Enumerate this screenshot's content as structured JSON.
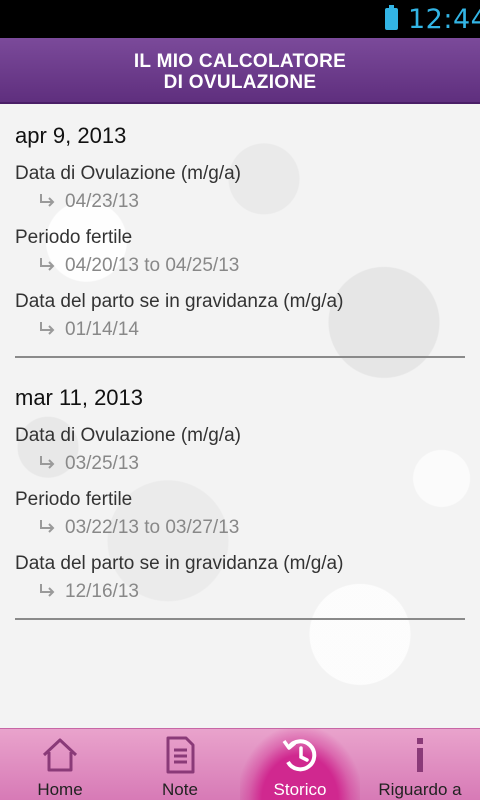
{
  "status_bar": {
    "time": "12:44",
    "battery_icon": "battery-full-icon"
  },
  "header": {
    "title_line1": "IL MIO CALCOLATORE",
    "title_line2": "DI OVULAZIONE"
  },
  "entries": [
    {
      "date": "apr 9, 2013",
      "ovulation_label": "Data di Ovulazione (m/g/a)",
      "ovulation_value": "04/23/13",
      "fertile_label": "Periodo fertile",
      "fertile_value": "04/20/13 to 04/25/13",
      "due_label": "Data del parto se in gravidanza (m/g/a)",
      "due_value": "01/14/14"
    },
    {
      "date": "mar 11, 2013",
      "ovulation_label": "Data di Ovulazione (m/g/a)",
      "ovulation_value": "03/25/13",
      "fertile_label": "Periodo fertile",
      "fertile_value": "03/22/13 to 03/27/13",
      "due_label": "Data del parto se in gravidanza (m/g/a)",
      "due_value": "12/16/13"
    }
  ],
  "nav": {
    "tabs": [
      {
        "label": "Home",
        "icon": "home-icon"
      },
      {
        "label": "Note",
        "icon": "notes-icon"
      },
      {
        "label": "Storico",
        "icon": "history-icon",
        "active": true
      },
      {
        "label": "Riguardo a",
        "icon": "info-icon"
      }
    ]
  },
  "colors": {
    "header": "#6b3a8c",
    "nav": "#e39ac6",
    "nav_active": "#d0288f",
    "status_accent": "#33b5e5"
  }
}
